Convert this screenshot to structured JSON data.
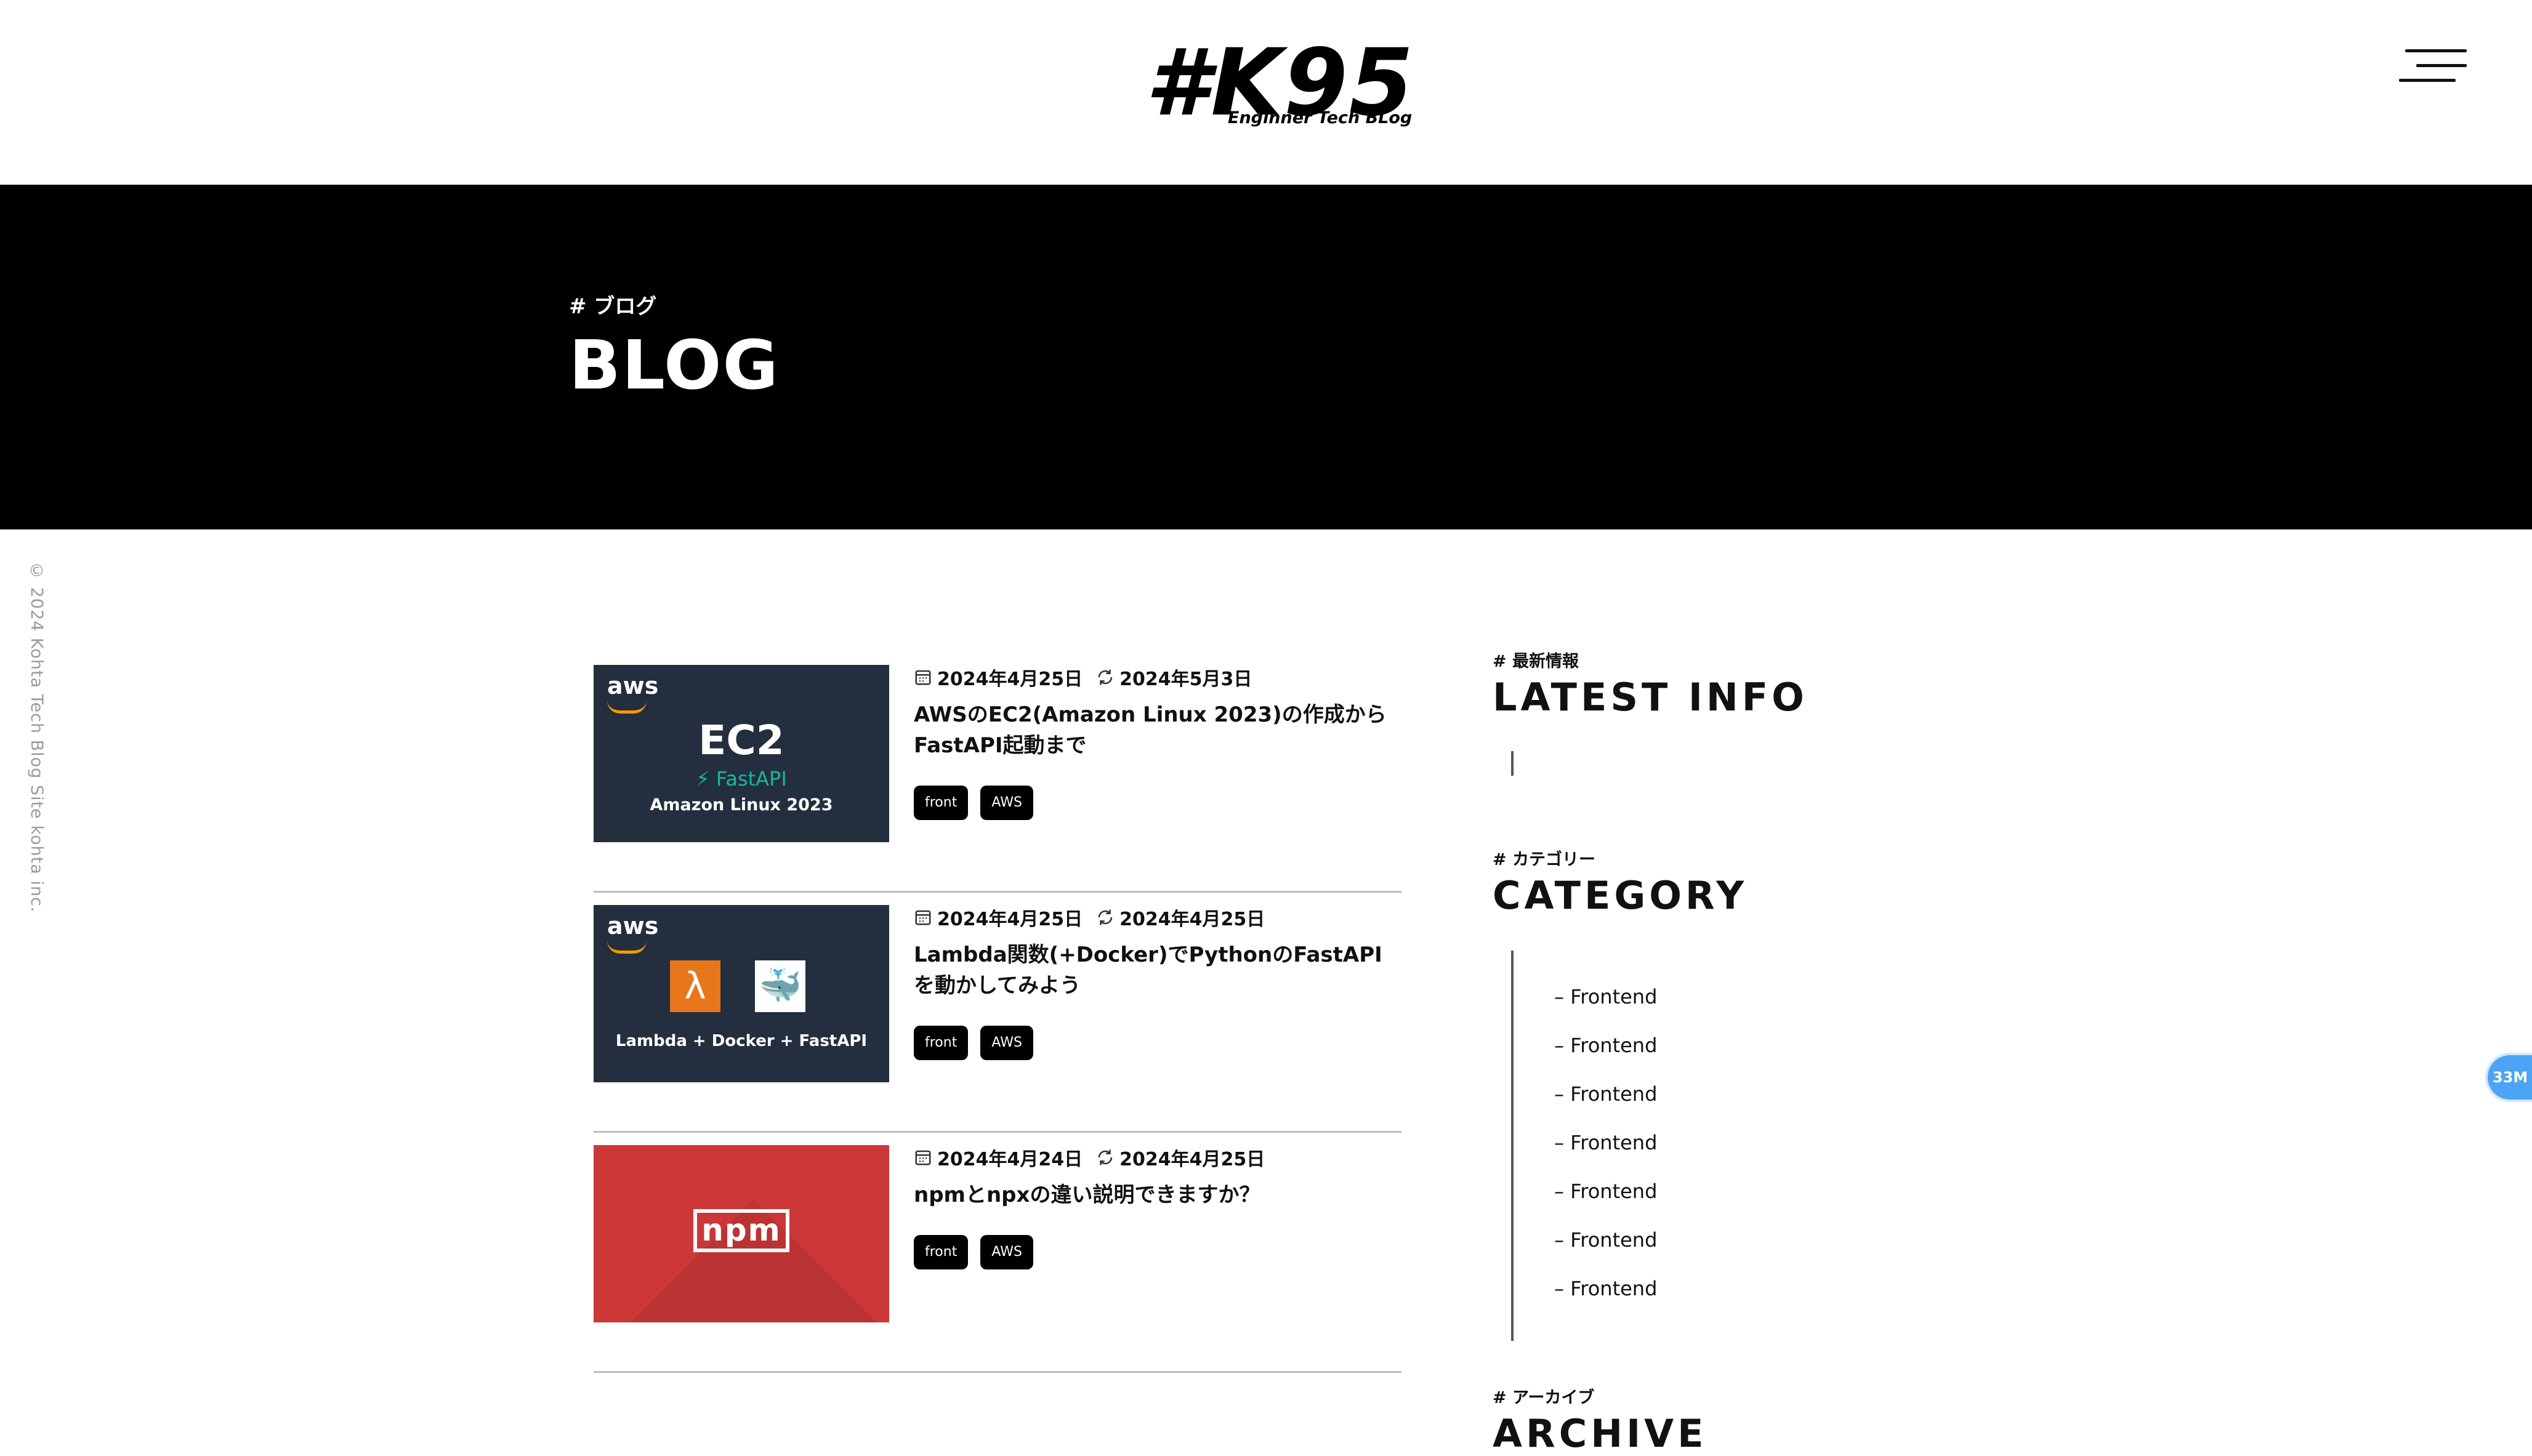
{
  "header": {
    "logo_main": "#K95",
    "logo_sub": "Enginner Tech BLog",
    "menu_icon": "hamburger-icon"
  },
  "hero": {
    "kicker": "# ブログ",
    "title": "BLOG"
  },
  "copyright": "© 2024 Kohta Tech Blog Site kohta inc.",
  "posts": [
    {
      "published": "2024年4月25日",
      "updated": "2024年5月3日",
      "title": "AWSのEC2(Amazon Linux 2023)の作成からFastAPI起動まで",
      "tags": [
        "front",
        "AWS"
      ],
      "thumb": {
        "brand": "aws",
        "main": "EC2",
        "sub": "FastAPI",
        "caption": "Amazon Linux 2023"
      }
    },
    {
      "published": "2024年4月25日",
      "updated": "2024年4月25日",
      "title": "Lambda関数(+Docker)でPythonのFastAPIを動かしてみよう",
      "tags": [
        "front",
        "AWS"
      ],
      "thumb": {
        "brand": "aws",
        "caption": "Lambda + Docker + FastAPI"
      }
    },
    {
      "published": "2024年4月24日",
      "updated": "2024年4月25日",
      "title": "npmとnpxの違い説明できますか？",
      "tags": [
        "front",
        "AWS"
      ],
      "thumb": {
        "logo": "npm"
      }
    }
  ],
  "sidebar": {
    "latest": {
      "kicker": "# 最新情報",
      "title": "LATEST INFO"
    },
    "category": {
      "kicker": "# カテゴリー",
      "title": "CATEGORY",
      "items": [
        "– Frontend",
        "– Frontend",
        "– Frontend",
        "– Frontend",
        "– Frontend",
        "– Frontend",
        "– Frontend"
      ]
    },
    "archive": {
      "kicker": "# アーカイブ",
      "title": "ARCHIVE"
    }
  },
  "float_badge": "33M",
  "colors": {
    "hero_bg": "#000000",
    "thumb_dark": "#232f3e",
    "thumb_npm": "#cb3837",
    "aws_orange": "#ff9900",
    "fastapi_teal": "#16b7a3",
    "badge_blue": "#4da3f5"
  }
}
